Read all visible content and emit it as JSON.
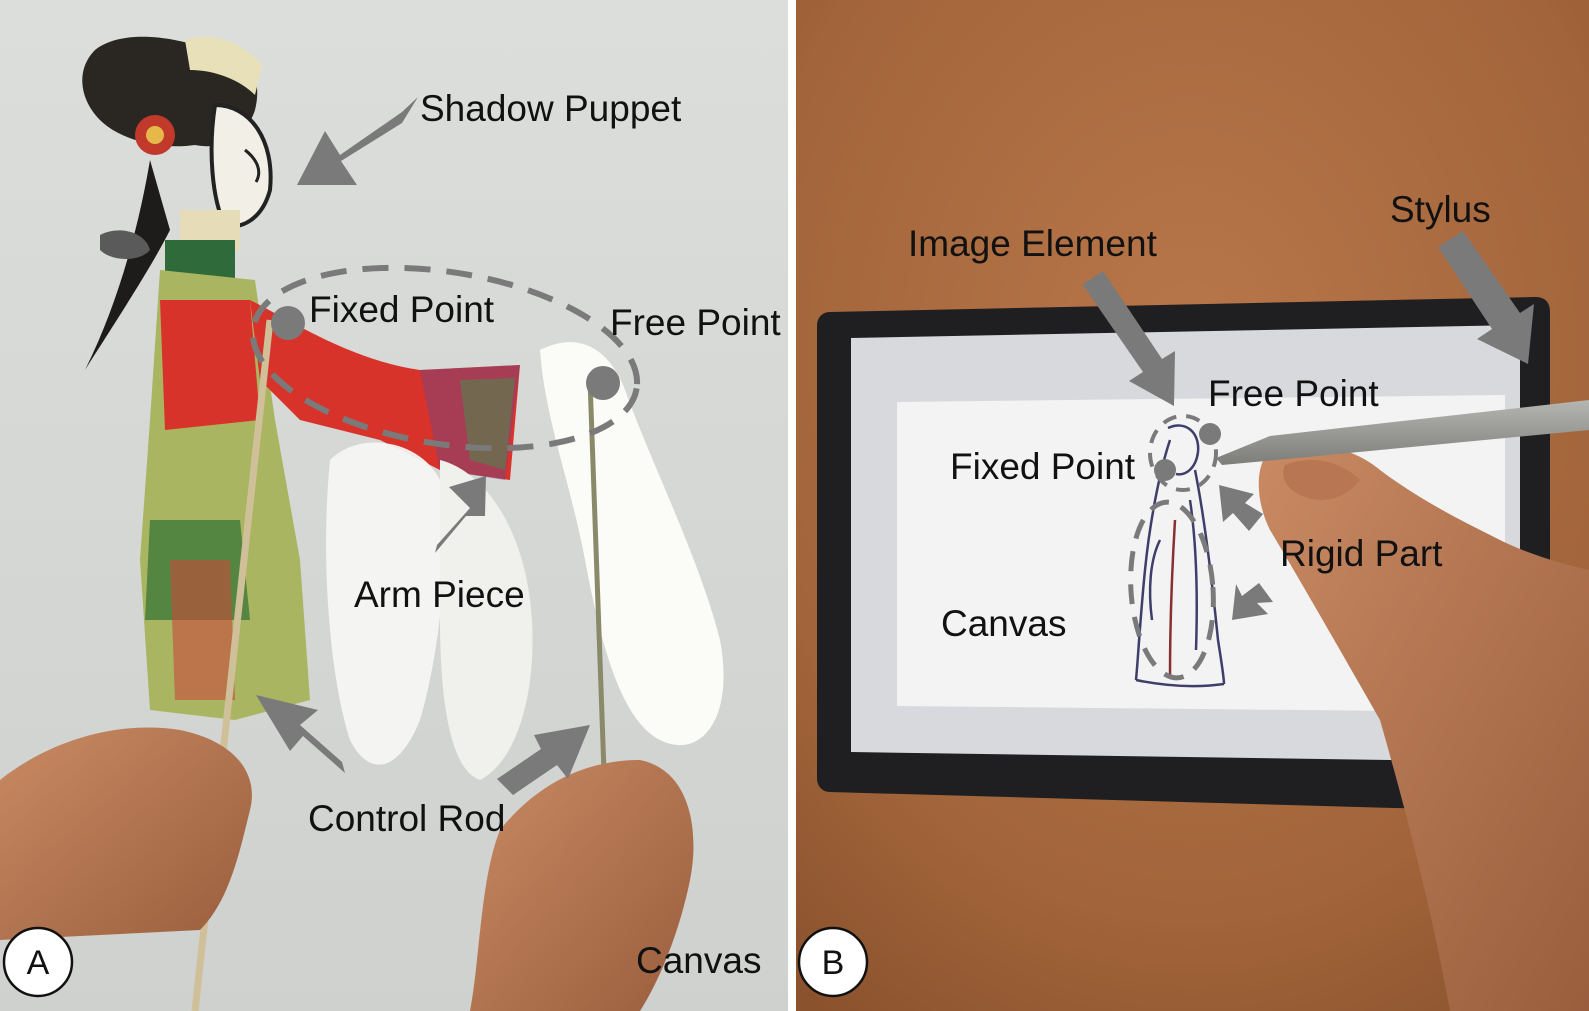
{
  "panel_a": {
    "badge": "A",
    "labels": {
      "shadow_puppet": "Shadow Puppet",
      "fixed_point": "Fixed Point",
      "free_point": "Free Point",
      "arm_piece": "Arm Piece",
      "control_rod": "Control Rod",
      "canvas": "Canvas"
    }
  },
  "panel_b": {
    "badge": "B",
    "labels": {
      "image_element": "Image Element",
      "stylus": "Stylus",
      "free_point": "Free Point",
      "fixed_point": "Fixed Point",
      "rigid_part": "Rigid Part",
      "canvas": "Canvas"
    }
  },
  "colors": {
    "annotation_gray": "#7a7a7a",
    "panel_a_background": "#d9dbd9",
    "panel_b_background": "#a6673a",
    "tablet_frame": "#1f1f22",
    "tablet_screen": "#f3f3f3"
  }
}
